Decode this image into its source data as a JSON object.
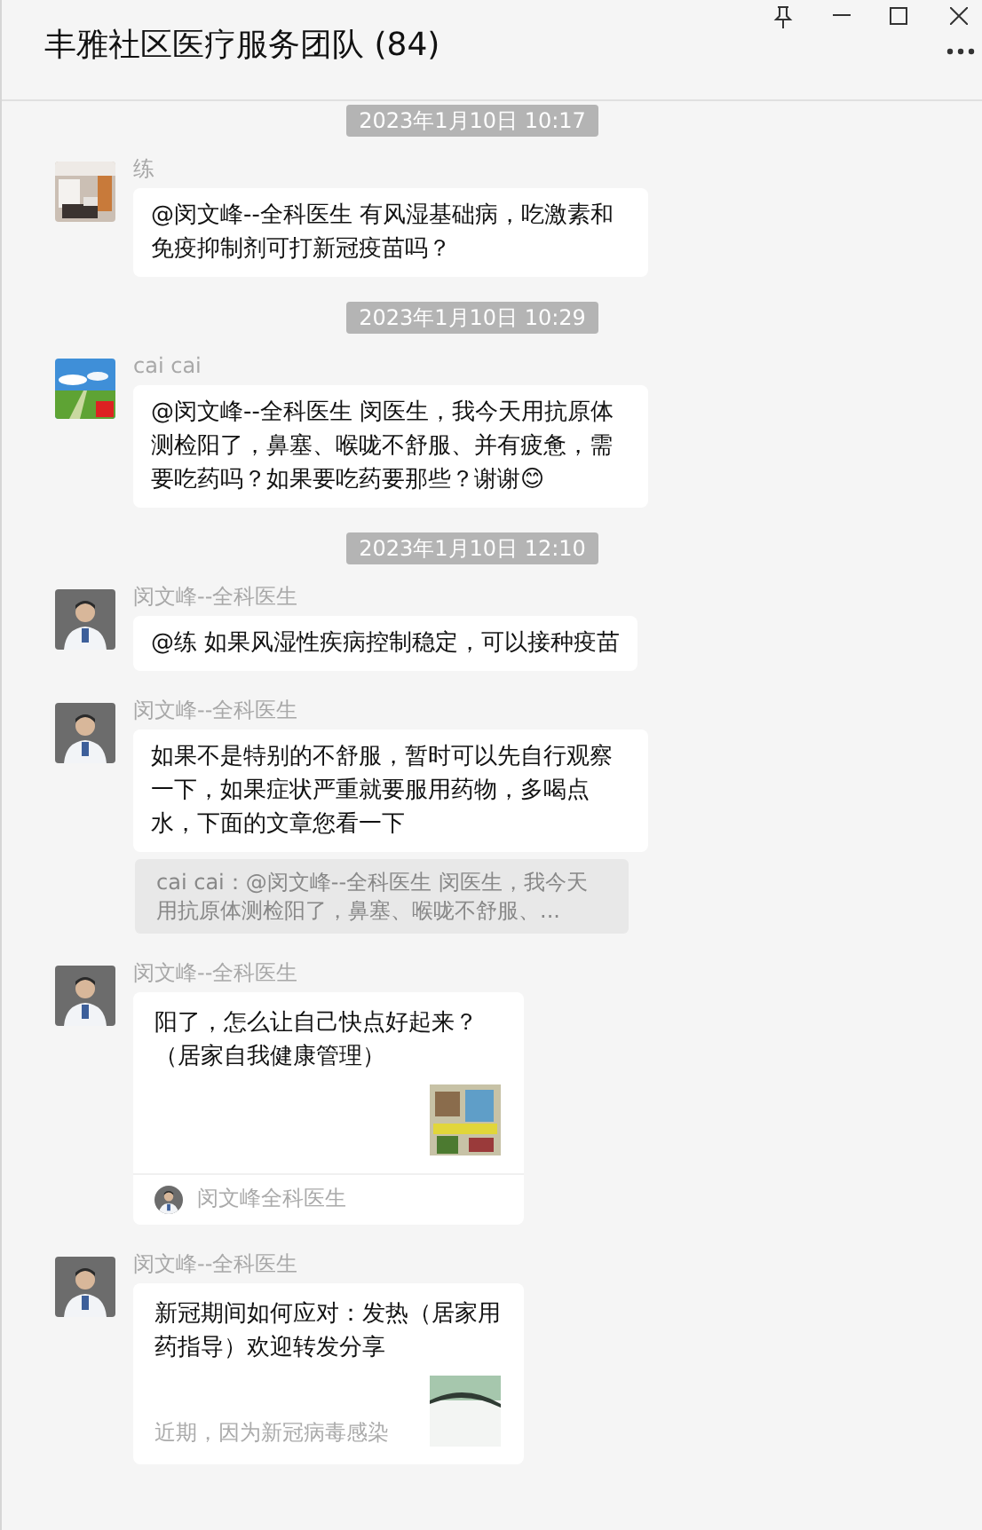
{
  "window": {
    "title": "丰雅社区医疗服务团队 (84)"
  },
  "messages": [
    {
      "kind": "time",
      "text": "2023年1月10日 10:17"
    },
    {
      "kind": "text",
      "sender": "练",
      "text": "@闵文峰--全科医生 有风湿基础病，吃激素和免疫抑制剂可打新冠疫苗吗？"
    },
    {
      "kind": "time",
      "text": "2023年1月10日 10:29"
    },
    {
      "kind": "text",
      "sender": "cai cai",
      "text": "@闵文峰--全科医生 闵医生，我今天用抗原体测检阳了，鼻塞、喉咙不舒服、并有疲惫，需要吃药吗？如果要吃药要那些？谢谢😊"
    },
    {
      "kind": "time",
      "text": "2023年1月10日 12:10"
    },
    {
      "kind": "text",
      "sender": "闵文峰--全科医生",
      "text": "@练 如果风湿性疾病控制稳定，可以接种疫苗"
    },
    {
      "kind": "text",
      "sender": "闵文峰--全科医生",
      "text": "如果不是特别的不舒服，暂时可以先自行观察一下，如果症状严重就要服用药物，多喝点水，下面的文章您看一下"
    },
    {
      "kind": "quote",
      "text": "cai cai：@闵文峰--全科医生 闵医生，我今天用抗原体测检阳了，鼻塞、喉咙不舒服、..."
    },
    {
      "kind": "card",
      "sender": "闵文峰--全科医生",
      "title": "阳了，怎么让自己快点好起来？（居家自我健康管理）",
      "source": "闵文峰全科医生"
    },
    {
      "kind": "card",
      "sender": "闵文峰--全科医生",
      "title": "新冠期间如何应对：发热（居家用药指导）欢迎转发分享",
      "description": "近期，因为新冠病毒感染"
    }
  ]
}
